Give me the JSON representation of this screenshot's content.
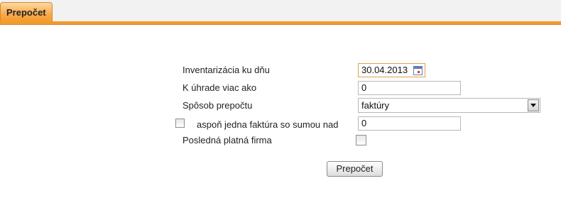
{
  "tabs": [
    {
      "label": "Prepočet",
      "active": true
    }
  ],
  "colors": {
    "accent": "#f39a2c",
    "tab_bg": "#f2f2f2"
  },
  "form": {
    "inventory_date": {
      "label": "Inventarizácia ku dňu",
      "value": "30.04.2013",
      "icon": "calendar-icon"
    },
    "payment_more_than": {
      "label": "K úhrade viac ako",
      "value": "0"
    },
    "method": {
      "label": "Spôsob prepočtu",
      "selected": "faktúry"
    },
    "at_least_one_invoice": {
      "label": "aspoň jedna faktúra so sumou nad",
      "value": "0",
      "checked": false
    },
    "last_valid_company": {
      "label": "Posledná platná firma",
      "checked": false
    },
    "submit_label": "Prepočet"
  }
}
